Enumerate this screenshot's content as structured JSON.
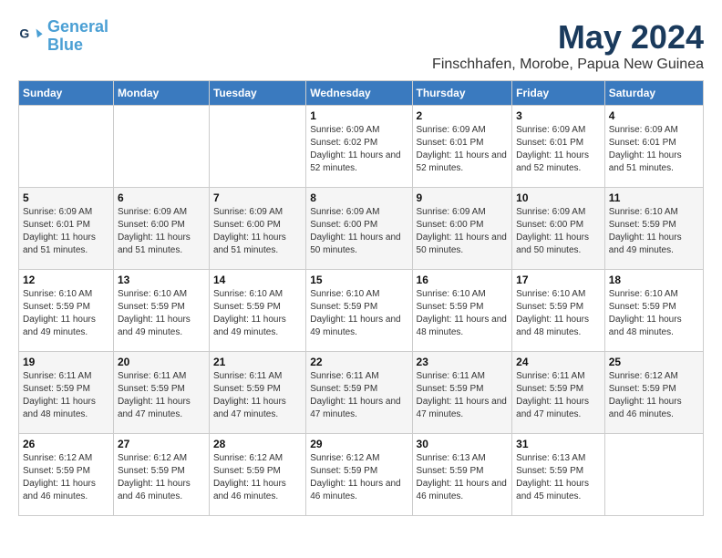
{
  "logo": {
    "line1": "General",
    "line2": "Blue"
  },
  "title": "May 2024",
  "subtitle": "Finschhafen, Morobe, Papua New Guinea",
  "headers": [
    "Sunday",
    "Monday",
    "Tuesday",
    "Wednesday",
    "Thursday",
    "Friday",
    "Saturday"
  ],
  "weeks": [
    [
      {
        "day": "",
        "sunrise": "",
        "sunset": "",
        "daylight": ""
      },
      {
        "day": "",
        "sunrise": "",
        "sunset": "",
        "daylight": ""
      },
      {
        "day": "",
        "sunrise": "",
        "sunset": "",
        "daylight": ""
      },
      {
        "day": "1",
        "sunrise": "Sunrise: 6:09 AM",
        "sunset": "Sunset: 6:02 PM",
        "daylight": "Daylight: 11 hours and 52 minutes."
      },
      {
        "day": "2",
        "sunrise": "Sunrise: 6:09 AM",
        "sunset": "Sunset: 6:01 PM",
        "daylight": "Daylight: 11 hours and 52 minutes."
      },
      {
        "day": "3",
        "sunrise": "Sunrise: 6:09 AM",
        "sunset": "Sunset: 6:01 PM",
        "daylight": "Daylight: 11 hours and 52 minutes."
      },
      {
        "day": "4",
        "sunrise": "Sunrise: 6:09 AM",
        "sunset": "Sunset: 6:01 PM",
        "daylight": "Daylight: 11 hours and 51 minutes."
      }
    ],
    [
      {
        "day": "5",
        "sunrise": "Sunrise: 6:09 AM",
        "sunset": "Sunset: 6:01 PM",
        "daylight": "Daylight: 11 hours and 51 minutes."
      },
      {
        "day": "6",
        "sunrise": "Sunrise: 6:09 AM",
        "sunset": "Sunset: 6:00 PM",
        "daylight": "Daylight: 11 hours and 51 minutes."
      },
      {
        "day": "7",
        "sunrise": "Sunrise: 6:09 AM",
        "sunset": "Sunset: 6:00 PM",
        "daylight": "Daylight: 11 hours and 51 minutes."
      },
      {
        "day": "8",
        "sunrise": "Sunrise: 6:09 AM",
        "sunset": "Sunset: 6:00 PM",
        "daylight": "Daylight: 11 hours and 50 minutes."
      },
      {
        "day": "9",
        "sunrise": "Sunrise: 6:09 AM",
        "sunset": "Sunset: 6:00 PM",
        "daylight": "Daylight: 11 hours and 50 minutes."
      },
      {
        "day": "10",
        "sunrise": "Sunrise: 6:09 AM",
        "sunset": "Sunset: 6:00 PM",
        "daylight": "Daylight: 11 hours and 50 minutes."
      },
      {
        "day": "11",
        "sunrise": "Sunrise: 6:10 AM",
        "sunset": "Sunset: 5:59 PM",
        "daylight": "Daylight: 11 hours and 49 minutes."
      }
    ],
    [
      {
        "day": "12",
        "sunrise": "Sunrise: 6:10 AM",
        "sunset": "Sunset: 5:59 PM",
        "daylight": "Daylight: 11 hours and 49 minutes."
      },
      {
        "day": "13",
        "sunrise": "Sunrise: 6:10 AM",
        "sunset": "Sunset: 5:59 PM",
        "daylight": "Daylight: 11 hours and 49 minutes."
      },
      {
        "day": "14",
        "sunrise": "Sunrise: 6:10 AM",
        "sunset": "Sunset: 5:59 PM",
        "daylight": "Daylight: 11 hours and 49 minutes."
      },
      {
        "day": "15",
        "sunrise": "Sunrise: 6:10 AM",
        "sunset": "Sunset: 5:59 PM",
        "daylight": "Daylight: 11 hours and 49 minutes."
      },
      {
        "day": "16",
        "sunrise": "Sunrise: 6:10 AM",
        "sunset": "Sunset: 5:59 PM",
        "daylight": "Daylight: 11 hours and 48 minutes."
      },
      {
        "day": "17",
        "sunrise": "Sunrise: 6:10 AM",
        "sunset": "Sunset: 5:59 PM",
        "daylight": "Daylight: 11 hours and 48 minutes."
      },
      {
        "day": "18",
        "sunrise": "Sunrise: 6:10 AM",
        "sunset": "Sunset: 5:59 PM",
        "daylight": "Daylight: 11 hours and 48 minutes."
      }
    ],
    [
      {
        "day": "19",
        "sunrise": "Sunrise: 6:11 AM",
        "sunset": "Sunset: 5:59 PM",
        "daylight": "Daylight: 11 hours and 48 minutes."
      },
      {
        "day": "20",
        "sunrise": "Sunrise: 6:11 AM",
        "sunset": "Sunset: 5:59 PM",
        "daylight": "Daylight: 11 hours and 47 minutes."
      },
      {
        "day": "21",
        "sunrise": "Sunrise: 6:11 AM",
        "sunset": "Sunset: 5:59 PM",
        "daylight": "Daylight: 11 hours and 47 minutes."
      },
      {
        "day": "22",
        "sunrise": "Sunrise: 6:11 AM",
        "sunset": "Sunset: 5:59 PM",
        "daylight": "Daylight: 11 hours and 47 minutes."
      },
      {
        "day": "23",
        "sunrise": "Sunrise: 6:11 AM",
        "sunset": "Sunset: 5:59 PM",
        "daylight": "Daylight: 11 hours and 47 minutes."
      },
      {
        "day": "24",
        "sunrise": "Sunrise: 6:11 AM",
        "sunset": "Sunset: 5:59 PM",
        "daylight": "Daylight: 11 hours and 47 minutes."
      },
      {
        "day": "25",
        "sunrise": "Sunrise: 6:12 AM",
        "sunset": "Sunset: 5:59 PM",
        "daylight": "Daylight: 11 hours and 46 minutes."
      }
    ],
    [
      {
        "day": "26",
        "sunrise": "Sunrise: 6:12 AM",
        "sunset": "Sunset: 5:59 PM",
        "daylight": "Daylight: 11 hours and 46 minutes."
      },
      {
        "day": "27",
        "sunrise": "Sunrise: 6:12 AM",
        "sunset": "Sunset: 5:59 PM",
        "daylight": "Daylight: 11 hours and 46 minutes."
      },
      {
        "day": "28",
        "sunrise": "Sunrise: 6:12 AM",
        "sunset": "Sunset: 5:59 PM",
        "daylight": "Daylight: 11 hours and 46 minutes."
      },
      {
        "day": "29",
        "sunrise": "Sunrise: 6:12 AM",
        "sunset": "Sunset: 5:59 PM",
        "daylight": "Daylight: 11 hours and 46 minutes."
      },
      {
        "day": "30",
        "sunrise": "Sunrise: 6:13 AM",
        "sunset": "Sunset: 5:59 PM",
        "daylight": "Daylight: 11 hours and 46 minutes."
      },
      {
        "day": "31",
        "sunrise": "Sunrise: 6:13 AM",
        "sunset": "Sunset: 5:59 PM",
        "daylight": "Daylight: 11 hours and 45 minutes."
      },
      {
        "day": "",
        "sunrise": "",
        "sunset": "",
        "daylight": ""
      }
    ]
  ]
}
